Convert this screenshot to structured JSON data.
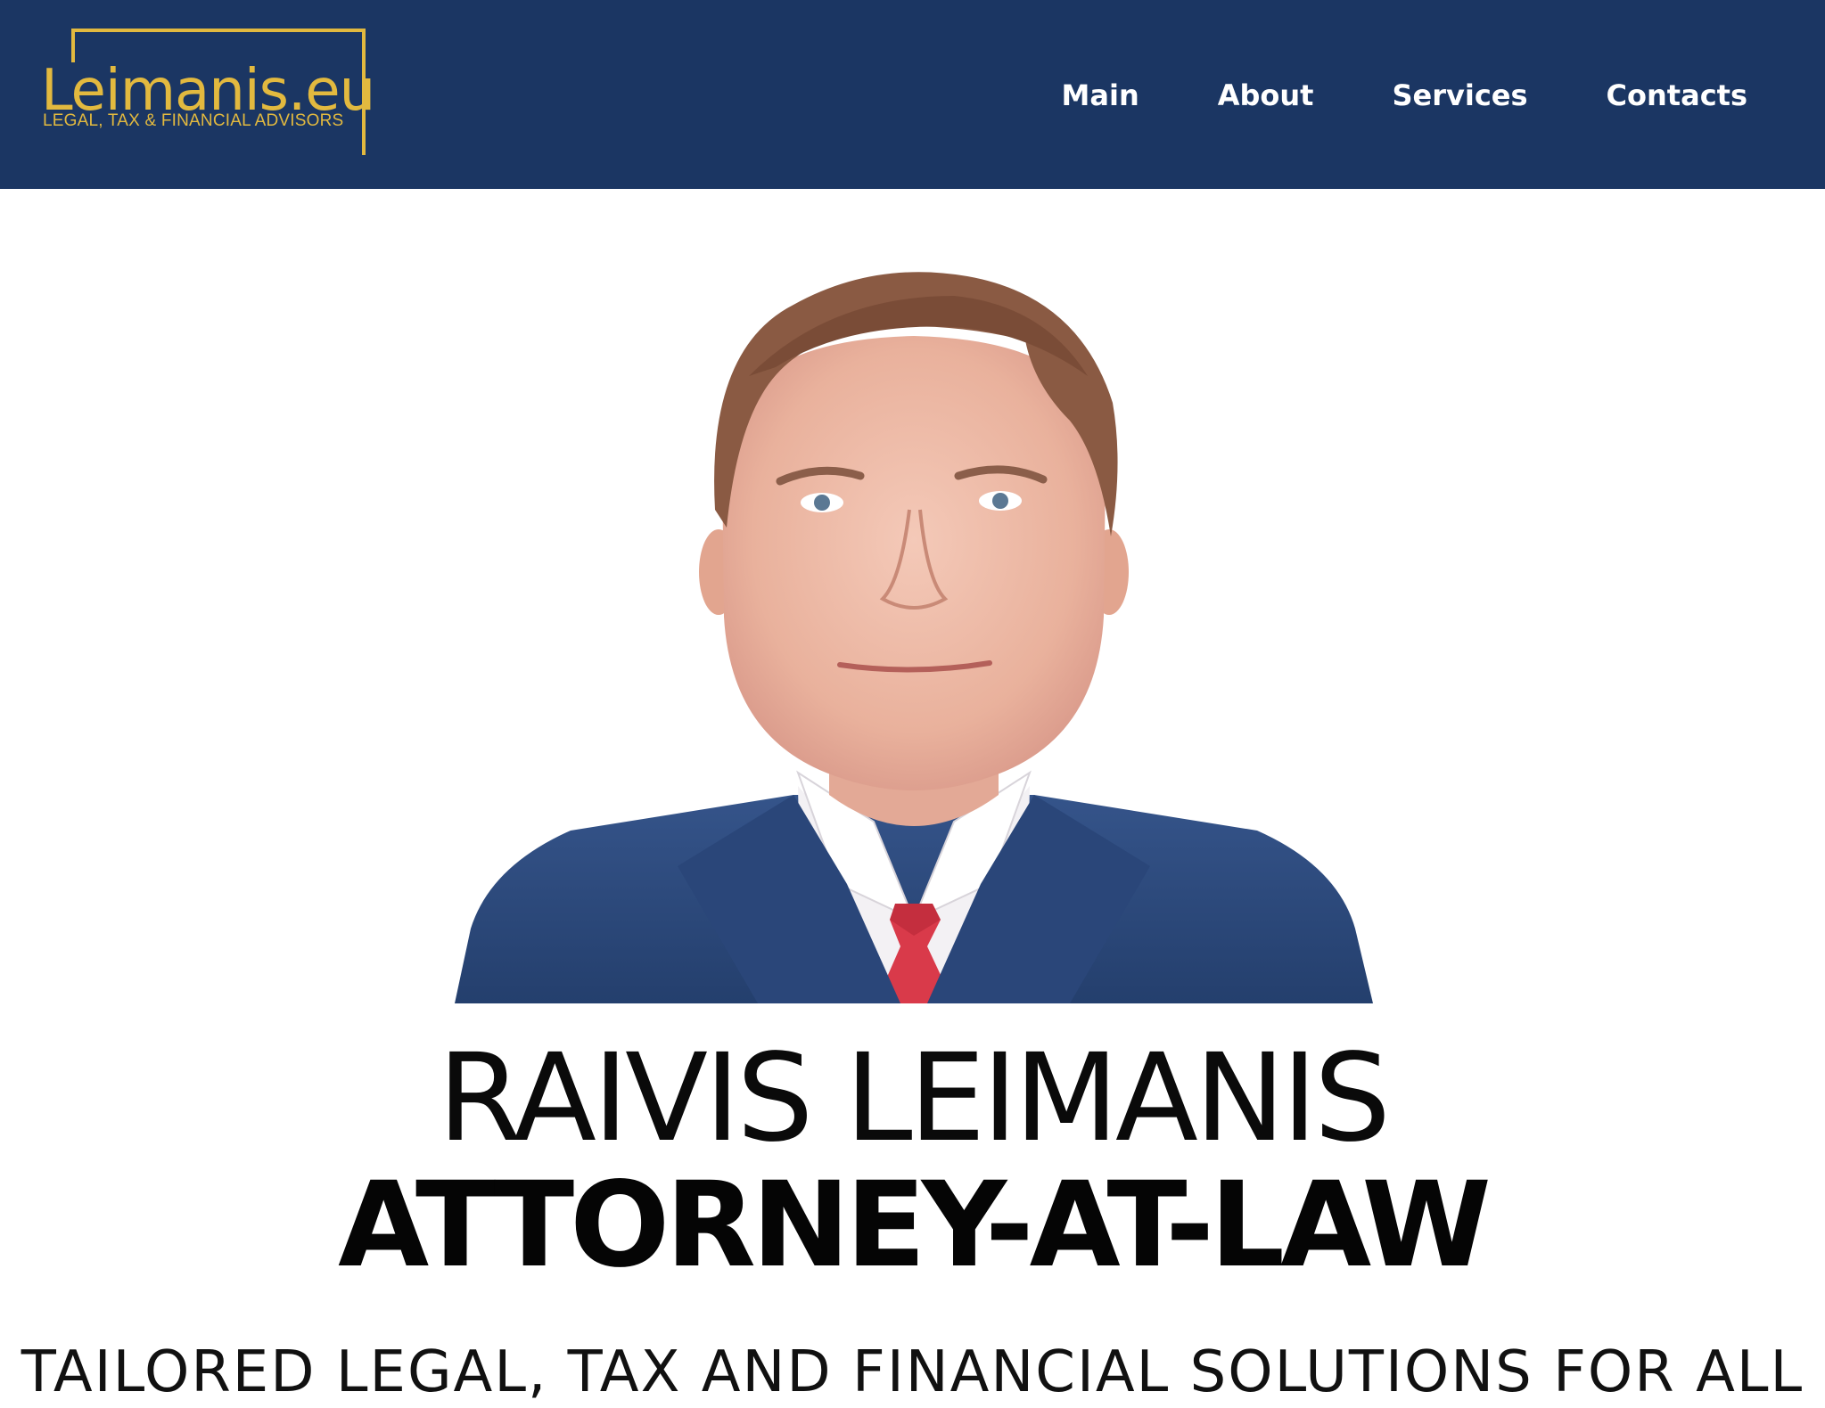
{
  "header": {
    "logo": {
      "name": "Leimanis.eu",
      "tagline": "LEGAL, TAX & FINANCIAL ADVISORS"
    },
    "nav": [
      {
        "label": "Main"
      },
      {
        "label": "About"
      },
      {
        "label": "Services"
      },
      {
        "label": "Contacts"
      }
    ]
  },
  "hero": {
    "name": "RAIVIS LEIMANIS",
    "title": "ATTORNEY-AT-LAW",
    "subtitle": "TAILORED LEGAL, TAX AND FINANCIAL SOLUTIONS FOR ALL"
  },
  "colors": {
    "header_bg": "#1b3663",
    "brand_gold": "#e2b93f",
    "suit": "#2c4a7c",
    "tie": "#d93a4a"
  }
}
